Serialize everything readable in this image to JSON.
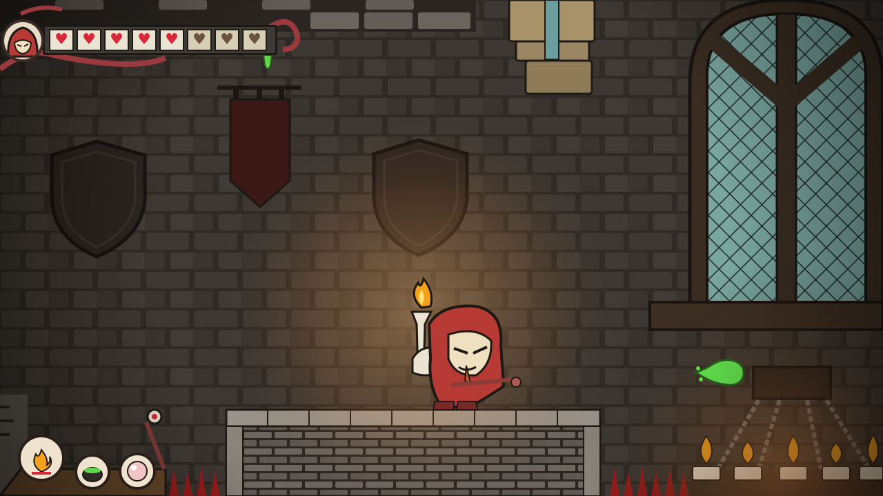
{
  "hud": {
    "health": {
      "hearts_total": 8,
      "hearts_full": 5,
      "full_glyph": "♥",
      "empty_glyph": "♥"
    },
    "portrait_icon": "hooded-hero-portrait-icon",
    "abilities": [
      {
        "name": "fire-ability-icon",
        "selected": true
      },
      {
        "name": "poison-cauldron-ability-icon",
        "selected": false
      },
      {
        "name": "bubble-ability-icon",
        "selected": false
      }
    ]
  },
  "colors": {
    "heart_full": "#d8283a",
    "hero_cloak": "#b83a35",
    "green_slime": "#5fd84a",
    "torch_flame": "#f4a21c",
    "window_glass": "#7aa6a0",
    "spikes": "#9a1c1c"
  }
}
